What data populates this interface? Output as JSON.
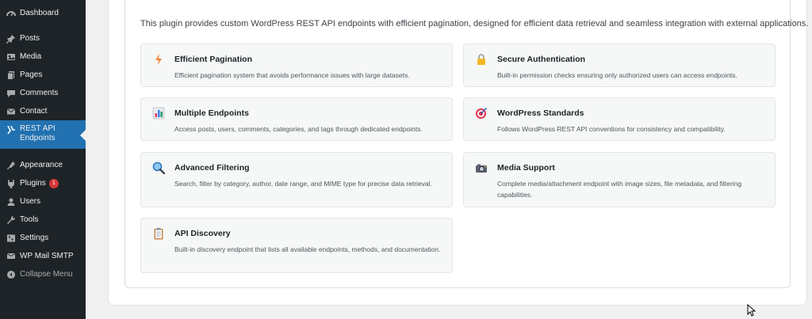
{
  "sidebar": {
    "items": [
      {
        "label": "Dashboard",
        "icon": "dashboard-icon"
      },
      {
        "label": "Posts",
        "icon": "pin-icon"
      },
      {
        "label": "Media",
        "icon": "media-icon"
      },
      {
        "label": "Pages",
        "icon": "pages-icon"
      },
      {
        "label": "Comments",
        "icon": "comments-icon"
      },
      {
        "label": "Contact",
        "icon": "mail-icon"
      },
      {
        "label": "REST API Endpoints",
        "icon": "rest-api-icon"
      },
      {
        "label": "Appearance",
        "icon": "appearance-icon"
      },
      {
        "label": "Plugins",
        "icon": "plugins-icon",
        "badge": "1"
      },
      {
        "label": "Users",
        "icon": "users-icon"
      },
      {
        "label": "Tools",
        "icon": "tools-icon"
      },
      {
        "label": "Settings",
        "icon": "settings-icon"
      },
      {
        "label": "WP Mail SMTP",
        "icon": "smtp-icon"
      },
      {
        "label": "Collapse Menu",
        "icon": "collapse-icon"
      }
    ]
  },
  "intro": "This plugin provides custom WordPress REST API endpoints with efficient pagination, designed for efficient data retrieval and seamless integration with external applications.",
  "features": [
    {
      "title": "Efficient Pagination",
      "description": "Efficient pagination system that avoids performance issues with large datasets.",
      "icon": "lightning-icon"
    },
    {
      "title": "Secure Authentication",
      "description": "Built-in permission checks ensuring only authorized users can access endpoints.",
      "icon": "lock-icon"
    },
    {
      "title": "Multiple Endpoints",
      "description": "Access posts, users, comments, categories, and tags through dedicated endpoints.",
      "icon": "bar-chart-icon"
    },
    {
      "title": "WordPress Standards",
      "description": "Follows WordPress REST API conventions for consistency and compatibility.",
      "icon": "target-icon"
    },
    {
      "title": "Advanced Filtering",
      "description": "Search, filter by category, author, date range, and MIME type for precise data retrieval.",
      "icon": "magnifier-icon"
    },
    {
      "title": "Media Support",
      "description": "Complete media/attachment endpoint with image sizes, file metadata, and filtering capabilities.",
      "icon": "camera-icon"
    },
    {
      "title": "API Discovery",
      "description": "Built-in discovery endpoint that lists all available endpoints, methods, and documentation.",
      "icon": "clipboard-icon"
    }
  ],
  "colors": {
    "sidebar_bg": "#1d2327",
    "active_bg": "#2271b1",
    "badge": "#d63638"
  }
}
